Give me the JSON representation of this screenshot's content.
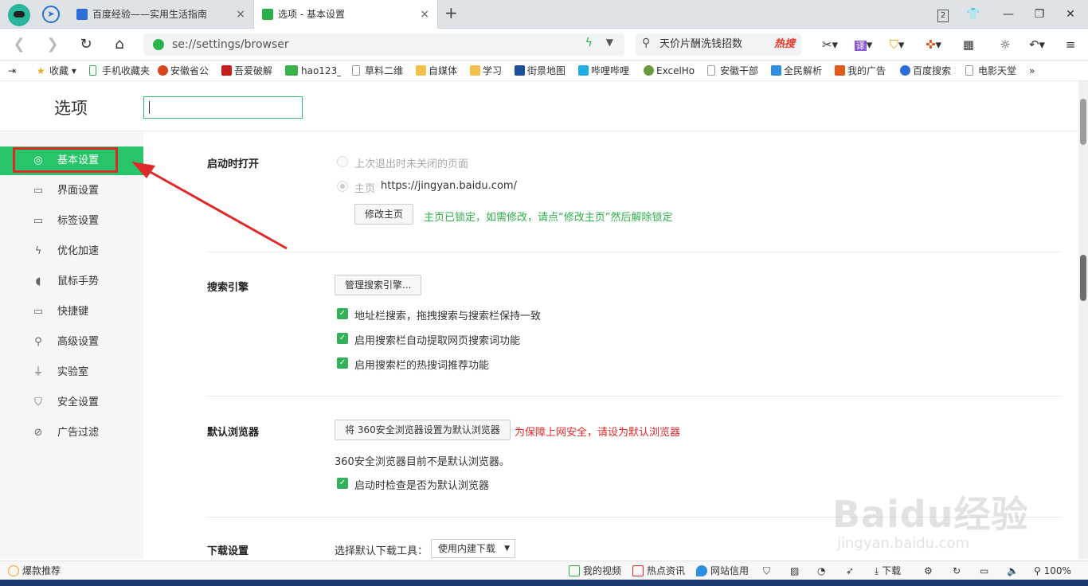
{
  "tabs": [
    {
      "title": "百度经验——实用生活指南",
      "close": "×"
    },
    {
      "title": "选项 - 基本设置",
      "close": "×"
    }
  ],
  "new_tab_glyph": "+",
  "window": {
    "tab_count": "2"
  },
  "address": {
    "url": "se://settings/browser",
    "search_placeholder": "天价片酬洗钱招数",
    "hot_label": "热搜"
  },
  "bookmarks": [
    {
      "label": "收藏",
      "color": "#f2a91a"
    },
    {
      "label": "手机收藏夹",
      "color": "#2cae4b"
    },
    {
      "label": "安徽省公",
      "color": "#d6451c"
    },
    {
      "label": "吾爱破解",
      "color": "#c81e1e"
    },
    {
      "label": "hao123_",
      "color": "#3cb04a"
    },
    {
      "label": "草料二维",
      "color": "#999999"
    },
    {
      "label": "自媒体",
      "color": "#f2c14e"
    },
    {
      "label": "学习",
      "color": "#f2c14e"
    },
    {
      "label": "街景地图",
      "color": "#1f4f9c"
    },
    {
      "label": "哔哩哔哩",
      "color": "#23ade5"
    },
    {
      "label": "ExcelHo",
      "color": "#6a9a3a"
    },
    {
      "label": "安徽干部",
      "color": "#999999"
    },
    {
      "label": "全民解析",
      "color": "#2f8ee0"
    },
    {
      "label": "我的广告",
      "color": "#e05a1c"
    },
    {
      "label": "百度搜索",
      "color": "#2b6fd6"
    },
    {
      "label": "电影天堂",
      "color": "#999999"
    }
  ],
  "bookmarks_more": "»",
  "options": {
    "title": "选项",
    "search_value": ""
  },
  "sidebar": [
    {
      "label": "基本设置",
      "icon": "gear-icon",
      "glyph": "◎"
    },
    {
      "label": "界面设置",
      "icon": "window-icon",
      "glyph": "▭"
    },
    {
      "label": "标签设置",
      "icon": "tab-icon",
      "glyph": "▭"
    },
    {
      "label": "优化加速",
      "icon": "bolt-icon",
      "glyph": "ϟ"
    },
    {
      "label": "鼠标手势",
      "icon": "mouse-icon",
      "glyph": "◖"
    },
    {
      "label": "快捷键",
      "icon": "keyboard-icon",
      "glyph": "▭"
    },
    {
      "label": "高级设置",
      "icon": "wrench-icon",
      "glyph": "⚲"
    },
    {
      "label": "实验室",
      "icon": "flask-icon",
      "glyph": "⏚"
    },
    {
      "label": "安全设置",
      "icon": "shield-icon",
      "glyph": "⛉"
    },
    {
      "label": "广告过滤",
      "icon": "block-icon",
      "glyph": "⊘"
    }
  ],
  "startup": {
    "title": "启动时打开",
    "option_last": "上次退出时未关闭的页面",
    "option_home_label": "主页",
    "home_url": "https://jingyan.baidu.com/",
    "modify_button": "修改主页",
    "locked_note": "主页已锁定，如需修改，请点“修改主页”然后解除锁定"
  },
  "search_engine": {
    "title": "搜索引擎",
    "manage_button": "管理搜索引擎...",
    "checks": [
      "地址栏搜索，拖拽搜索与搜索栏保持一致",
      "启用搜索栏自动提取网页搜索词功能",
      "启用搜索栏的热搜词推荐功能"
    ]
  },
  "default_browser": {
    "title": "默认浏览器",
    "set_button": "将 360安全浏览器设置为默认浏览器",
    "warning": "为保障上网安全，请设为默认浏览器",
    "status": "360安全浏览器目前不是默认浏览器。",
    "check_label": "启动时检查是否为默认浏览器"
  },
  "download": {
    "title": "下载设置",
    "tool_label": "选择默认下载工具：",
    "tool_value": "使用内建下载"
  },
  "watermark": {
    "brand": "Baidu经验",
    "site": "jingyan.baidu.com"
  },
  "status": {
    "left": "爆款推荐",
    "my_video": "我的视频",
    "hot_news": "热点资讯",
    "site_credit": "网站信用",
    "download": "下载",
    "zoom": "100%"
  },
  "colors": {
    "accent_green": "#28c46a",
    "annotation_red": "#e02a2a"
  }
}
